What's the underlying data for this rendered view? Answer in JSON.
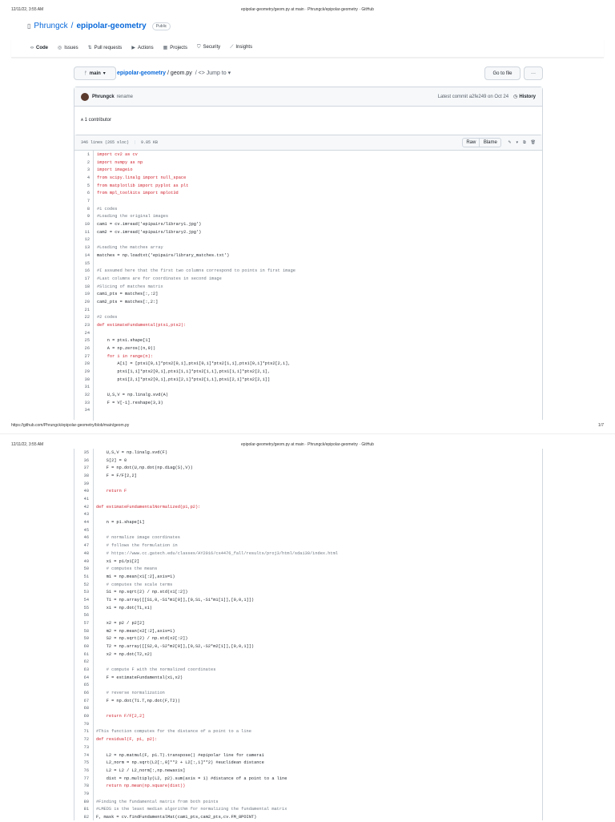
{
  "print": {
    "timestamp": "12/11/22, 3:55 AM",
    "title": "epipolar-geometry/geom.py at main · Phrungck/epipolar-geometry · GitHub",
    "url": "https://github.com/Phrungck/epipolar-geometry/blob/main/geom.py",
    "page": "1/7"
  },
  "repo": {
    "owner": "Phrungck",
    "sep": "/",
    "name": "epipolar-geometry",
    "visibility": "Public"
  },
  "nav": [
    "Code",
    "Issues",
    "Pull requests",
    "Actions",
    "Projects",
    "Security",
    "Insights"
  ],
  "file_bar": {
    "branch": "main",
    "repo_link": "epipolar-geometry",
    "file": "/ geom.py",
    "jump": "/ <> Jump to ▾",
    "go_to_file": "Go to file",
    "more": "···"
  },
  "commit": {
    "author": "Phrungck",
    "message": "rename",
    "latest": "Latest commit a2fe249 on Oct 24",
    "history": "History",
    "contributors": "1 contributor"
  },
  "file_info": {
    "lines": "346 lines (265 sloc)",
    "size": "9.85 KB",
    "raw": "Raw",
    "blame": "Blame"
  },
  "code": {
    "page1": [
      "import cv2 as cv",
      "import numpy as np",
      "import imageio",
      "from scipy.linalg import null_space",
      "from matplotlib import pyplot as plt",
      "from mpl_toolkits import mplot3d",
      "",
      "#1 codes",
      "#Loading the original images",
      "cam1 = cv.imread('epipairs/library1.jpg')",
      "cam2 = cv.imread('epipairs/library2.jpg')",
      "",
      "#Loading the matches array",
      "matches = np.loadtxt('epipairs/library_matches.txt')",
      "",
      "#I assumed here that the first two columns correspond to points in first image",
      "#Last columns are for coordinates in second image",
      "#Slicing of matches matrix",
      "cam1_pts = matches[:,:2]",
      "cam2_pts = matches[:,2:]",
      "",
      "#2 codes",
      "def estimateFundamental(pts1,pts2):",
      "",
      "    n = pts1.shape[1]",
      "    A = np.zeros((n,9))",
      "    for i in range(n):",
      "        A[i] = [pts1[0,i]*pts2[0,i],pts1[0,i]*pts2[1,i],pts1[0,i]*pts2[2,i],",
      "        pts1[1,i]*pts2[0,i],pts1[1,i]*pts2[1,i],pts1[1,i]*pts2[2,i],",
      "        pts1[2,i]*pts2[0,i],pts1[2,i]*pts2[1,i],pts1[2,i]*pts2[2,i]]",
      "",
      "    U,S,V = np.linalg.svd(A)",
      "    F = V[-1].reshape(3,3)",
      ""
    ],
    "page2": [
      "    U,S,V = np.linalg.svd(F)",
      "    S[2] = 0",
      "    F = np.dot(U,np.dot(np.diag(S),V))",
      "    F = F/F[2,2]",
      "",
      "    return F",
      "",
      "def estimateFundamentalNormalized(p1,p2):",
      "",
      "    n = p1.shape[1]",
      "",
      "    # normalize image coordinates",
      "    # follows the formulation in",
      "    # https://www.cc.gatech.edu/classes/AY2016/cs4476_fall/results/proj3/html/sdai30/index.html",
      "    x1 = p1/p1[2]",
      "    # computes the means",
      "    m1 = np.mean(x1[:2],axis=1)",
      "    # computes the scale terms",
      "    S1 = np.sqrt(2) / np.std(x1[:2])",
      "    T1 = np.array([[S1,0,-S1*m1[0]],[0,S1,-S1*m1[1]],[0,0,1]])",
      "    x1 = np.dot(T1,x1)",
      "",
      "    x2 = p2 / p2[2]",
      "    m2 = np.mean(x2[:2],axis=1)",
      "    S2 = np.sqrt(2) / np.std(x2[:2])",
      "    T2 = np.array([[S2,0,-S2*m2[0]],[0,S2,-S2*m2[1]],[0,0,1]])",
      "    x2 = np.dot(T2,x2)",
      "",
      "    # compute F with the normalized coordinates",
      "    F = estimateFundamental(x1,x2)",
      "",
      "    # reverse normalization",
      "    F = np.dot(T1.T,np.dot(F,T2))",
      "",
      "    return F/F[2,2]",
      "",
      "#This function computes for the distance of a point to a line",
      "def residual(F, p1, p2):",
      "",
      "    L2 = np.matmul(F, p1.T).transpose() #epipolar line for camera1",
      "    L2_norm = np.sqrt(L2[:,0]**2 + L2[:,1]**2) #euclidean distance",
      "    L2 = L2 / L2_norm[:,np.newaxis]",
      "    dist = np.multiply(L2, p2).sum(axis = 1) #distance of a point to a line",
      "    return np.mean(np.square(dist))",
      "",
      "#Finding the fundamental matrix from both points",
      "#LMEDS is the least median algorithm for normalizing the fundamental matrix",
      "F, mask = cv.findFundamentalMat(cam1_pts,cam2_pts,cv.FM_8POINT)"
    ]
  }
}
